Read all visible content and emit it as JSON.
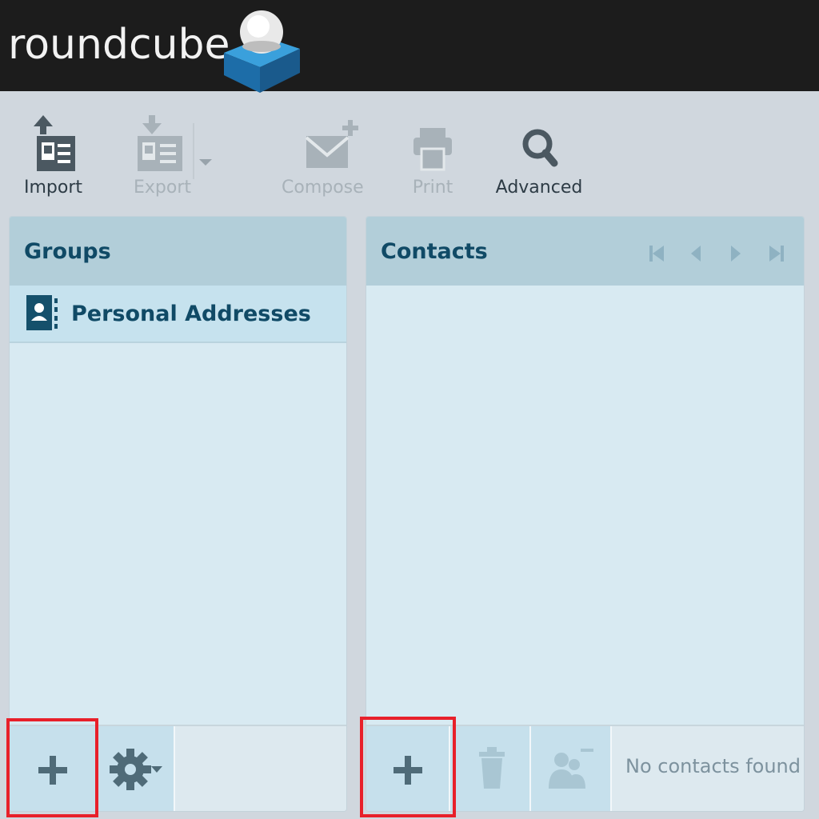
{
  "app": {
    "logo_text": "roundcube"
  },
  "toolbar": {
    "import_label": "Import",
    "export_label": "Export",
    "compose_label": "Compose",
    "print_label": "Print",
    "advanced_label": "Advanced"
  },
  "groups_panel": {
    "title": "Groups",
    "items": [
      {
        "label": "Personal Addresses",
        "icon": "address-book-icon"
      }
    ]
  },
  "contacts_panel": {
    "title": "Contacts",
    "status": "No contacts found"
  },
  "colors": {
    "header_bg": "#1c1c1c",
    "panel_header": "#b2ced9",
    "panel_body": "#d8eaf2",
    "title_text": "#104a66",
    "highlight": "#e8202a"
  }
}
